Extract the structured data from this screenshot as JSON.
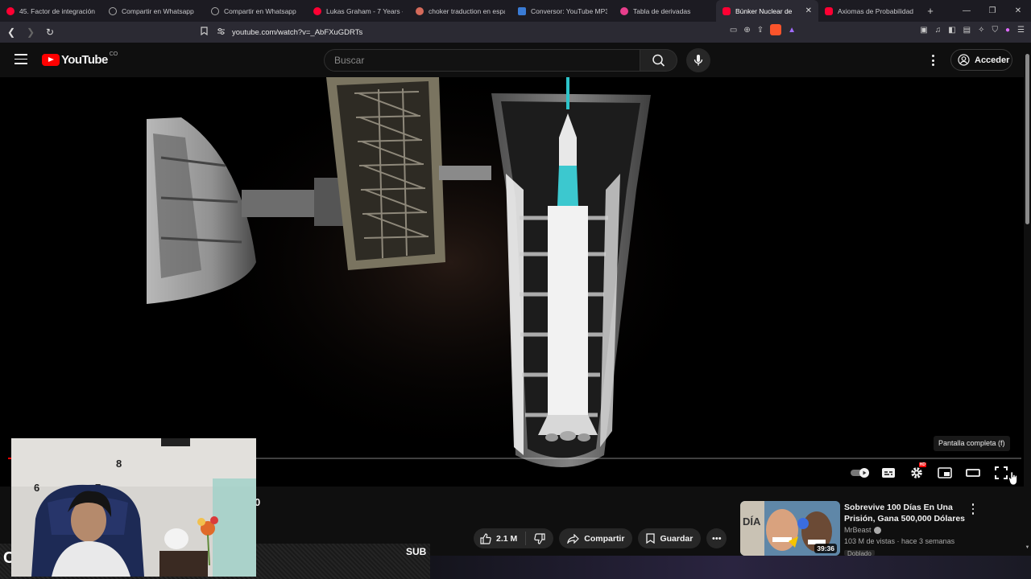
{
  "browser": {
    "tabs": [
      {
        "title": "45. Factor de integración",
        "color": "#ff0033"
      },
      {
        "title": "Compartir en Whatsapp",
        "color": "#888888"
      },
      {
        "title": "Compartir en Whatsapp",
        "color": "#888888"
      },
      {
        "title": "Lukas Graham - 7 Years - Y",
        "color": "#ff0033"
      },
      {
        "title": "choker traduction en espa",
        "color": "#d46a5a"
      },
      {
        "title": "Conversor: YouTube MP3,",
        "color": "#3a7bd5"
      },
      {
        "title": "Tabla de derivadas",
        "color": "#e83e8c"
      },
      {
        "title": "Búnker Nuclear de",
        "color": "#ff0033",
        "active": true
      },
      {
        "title": "Axiomas de Probabilidad",
        "color": "#ff0033"
      }
    ],
    "url": "youtube.com/watch?v=_AbFXuGDRTs"
  },
  "youtube": {
    "logo_text": "YouTube",
    "country_code": "CO",
    "search_placeholder": "Buscar",
    "signin_label": "Acceder"
  },
  "player": {
    "tooltip": "Pantalla completa (f)",
    "progress_fraction": 0.004,
    "accent_color": "#ff0000"
  },
  "video_meta": {
    "title_fragment": "0",
    "likes": "2.1 M",
    "share_label": "Compartir",
    "save_label": "Guardar"
  },
  "recommended": {
    "title": "Sobrevive 100 Días En Una Prisión, Gana 500,000 Dólares",
    "channel": "MrBeast",
    "stats": "103 M de vistas · hace 3 semanas",
    "duration": "39:36",
    "badge": "Doblado"
  },
  "overlay": {
    "sub_text": "SUB",
    "left_char": "C"
  }
}
